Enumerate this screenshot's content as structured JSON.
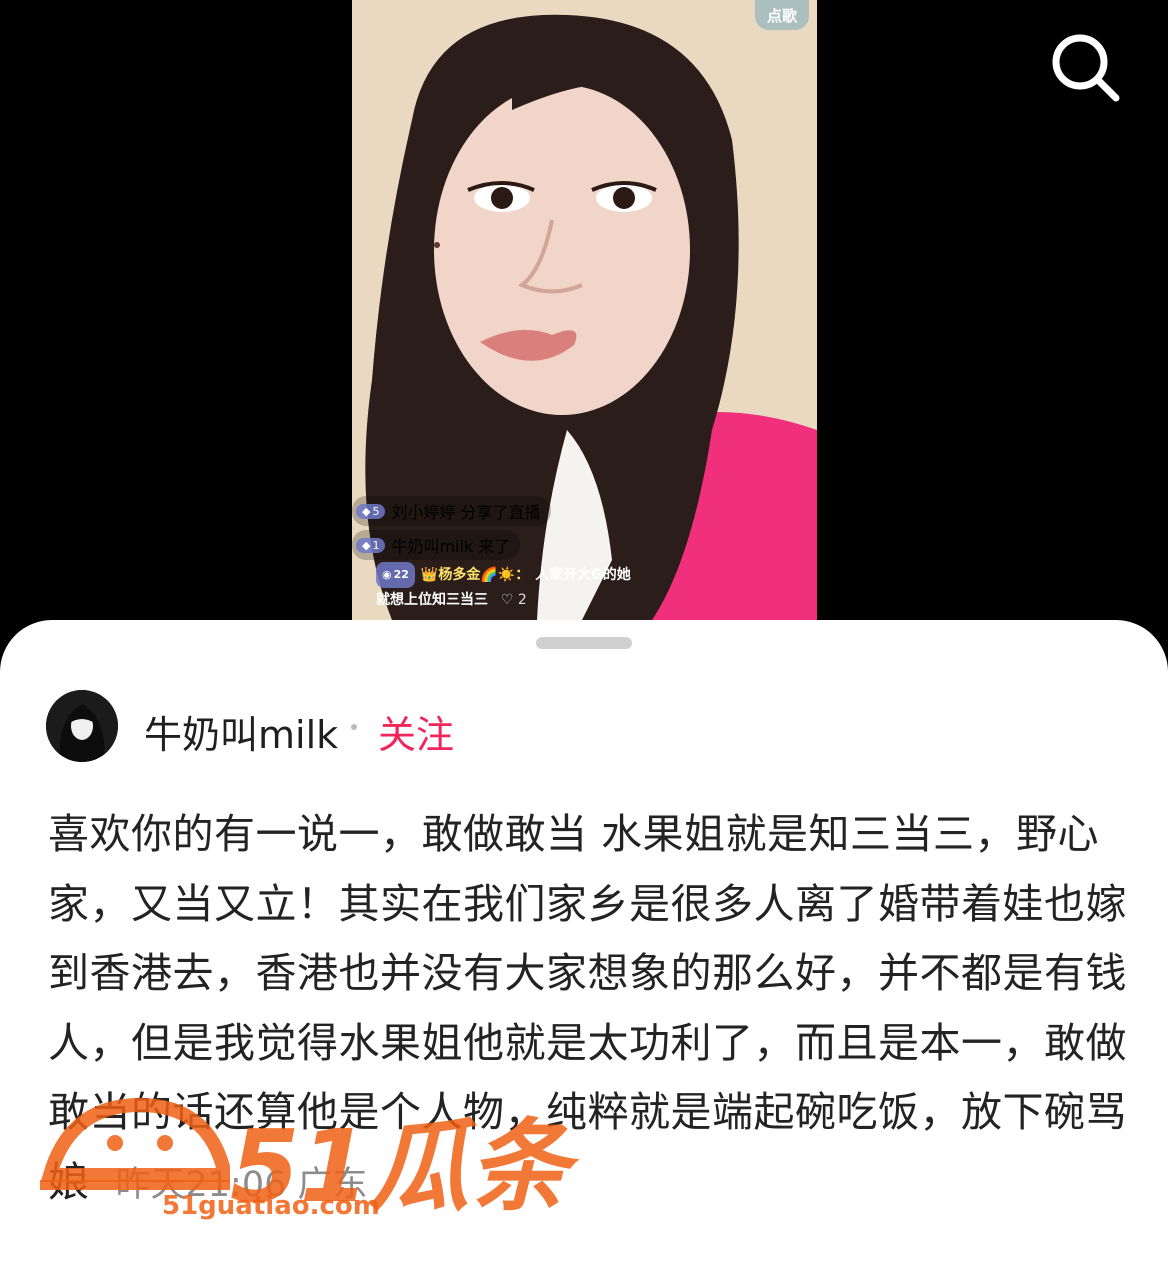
{
  "video": {
    "song_badge": "点歌",
    "chat": [
      {
        "level": "5",
        "text": "刘小婷婷 分享了直播"
      },
      {
        "level": "1",
        "text": "牛奶叫milk 来了"
      }
    ],
    "chat_message": {
      "level": "22",
      "user": "杨多金🌈☀️：",
      "text_line1": "人家开大G的她",
      "text_line2": "就想上位知三当三",
      "likes": "♡ 2"
    }
  },
  "comment": {
    "author": "牛奶叫milk",
    "follow_label": "关注",
    "text": "喜欢你的有一说一，敢做敢当 水果姐就是知三当三，野心家，又当又立！其实在我们家乡是很多人离了婚带着娃也嫁到香港去，香港也并没有大家想象的那么好，并不都是有钱人，但是我觉得水果姐他就是太功利了，而且是本一，敢做敢当的话还算他是个人物，纯粹就是端起碗吃饭，放下碗骂娘",
    "time": "昨天21:06",
    "location": "广东"
  },
  "watermark": {
    "logo_text": "51瓜条",
    "url": "51guatiao.com"
  },
  "colors": {
    "follow": "#f0255c",
    "watermark": "#f06014"
  }
}
